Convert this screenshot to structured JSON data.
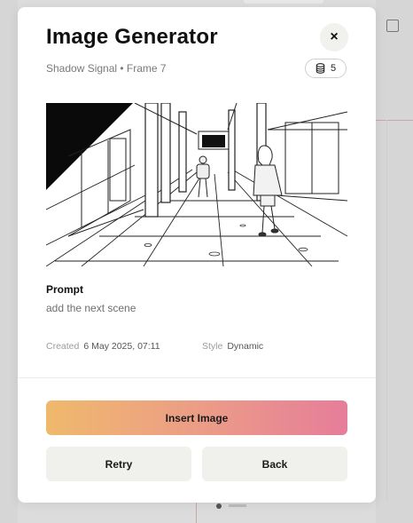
{
  "modal": {
    "title": "Image Generator",
    "subtitle": "Shadow Signal • Frame 7",
    "close_label": "×",
    "credits": "5",
    "prompt_label": "Prompt",
    "prompt_text": "add the next scene",
    "created_label": "Created",
    "created_value": "6 May 2025, 07:11",
    "style_label": "Style",
    "style_value": "Dynamic",
    "insert_label": "Insert Image",
    "retry_label": "Retry",
    "back_label": "Back"
  },
  "icons": {
    "close": "close-icon",
    "credits": "coin-stack-icon"
  },
  "colors": {
    "gradient_start": "#efb96c",
    "gradient_end": "#e67d9a",
    "secondary_button": "#f0f0ec"
  }
}
